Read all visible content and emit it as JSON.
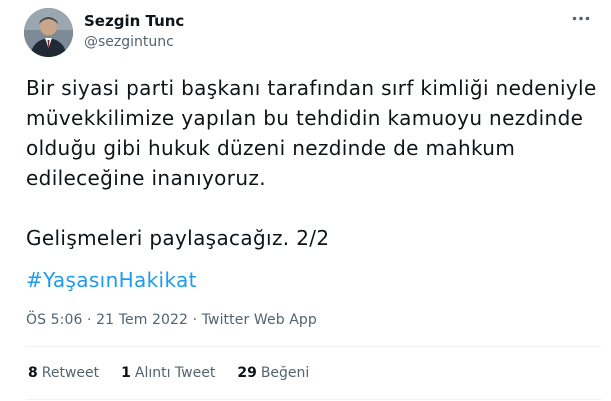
{
  "author": {
    "name": "Sezgin Tunc",
    "handle": "@sezgintunc"
  },
  "tweet": {
    "lines": [
      "Bir siyasi parti başkanı tarafından sırf kimliği nedeniyle",
      "müvekkilimize yapılan bu tehdidin kamuoyu nezdinde",
      "olduğu gibi hukuk düzeni nezdinde de mahkum",
      "edileceğine inanıyoruz."
    ],
    "line2": "Gelişmeleri paylaşacağız. 2/2",
    "hashtag": "#YaşasınHakikat"
  },
  "meta": {
    "time": "ÖS 5:06",
    "separator1": " · ",
    "date": "21 Tem 2022",
    "separator2": " · ",
    "source": "Twitter Web App"
  },
  "stats": {
    "retweets_count": "8",
    "retweets_label": "Retweet",
    "quotes_count": "1",
    "quotes_label": "Alıntı Tweet",
    "likes_count": "29",
    "likes_label": "Beğeni"
  },
  "colors": {
    "text": "#0f1419",
    "secondary": "#536471",
    "link": "#1d9bf0",
    "divider": "#eff3f4"
  },
  "icons": {
    "more": "more-horizontal-icon"
  }
}
